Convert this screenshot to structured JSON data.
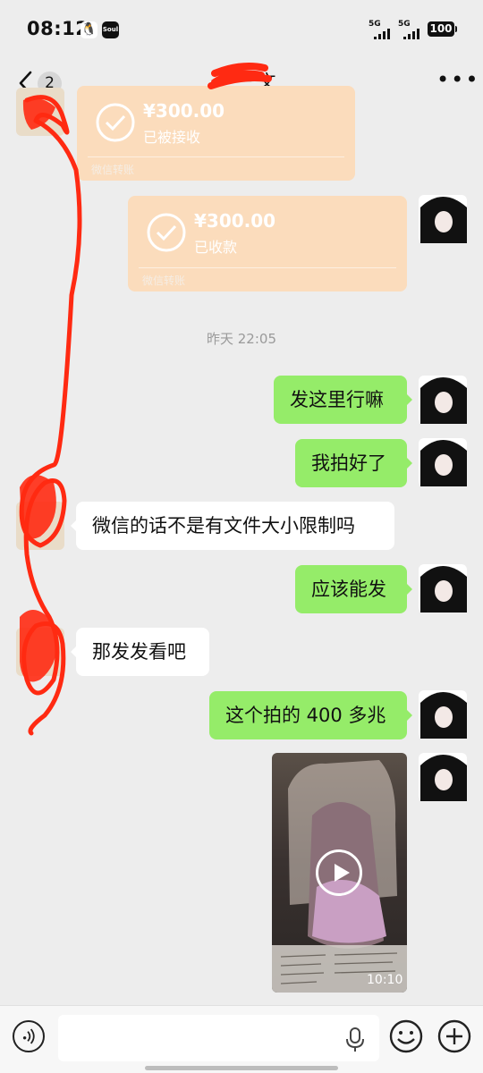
{
  "status_bar": {
    "time": "08:12",
    "network_1": "5G",
    "network_2": "5G",
    "battery": "100",
    "apps": [
      "qq-icon",
      "soul-icon"
    ]
  },
  "nav": {
    "back_count": "2",
    "title": "一 一 文",
    "more": "•••"
  },
  "messages": {
    "transfer_1": {
      "amount": "¥300.00",
      "status": "已被接收",
      "label": "微信转账"
    },
    "transfer_2": {
      "amount": "¥300.00",
      "status": "已收款",
      "label": "微信转账"
    },
    "timestamp": "昨天 22:05",
    "m1": "发这里行嘛",
    "m2": "我拍好了",
    "m3": "微信的话不是有文件大小限制吗",
    "m4": "应该能发",
    "m5": "那发发看吧",
    "m6": "这个拍的 400 多兆",
    "video": {
      "duration": "10:10"
    }
  },
  "colors": {
    "chat_bg": "#ededed",
    "my_bubble": "#95ec69",
    "other_bubble": "#ffffff",
    "transfer_card": "#fbdcbc",
    "redaction": "#ff2a12"
  }
}
